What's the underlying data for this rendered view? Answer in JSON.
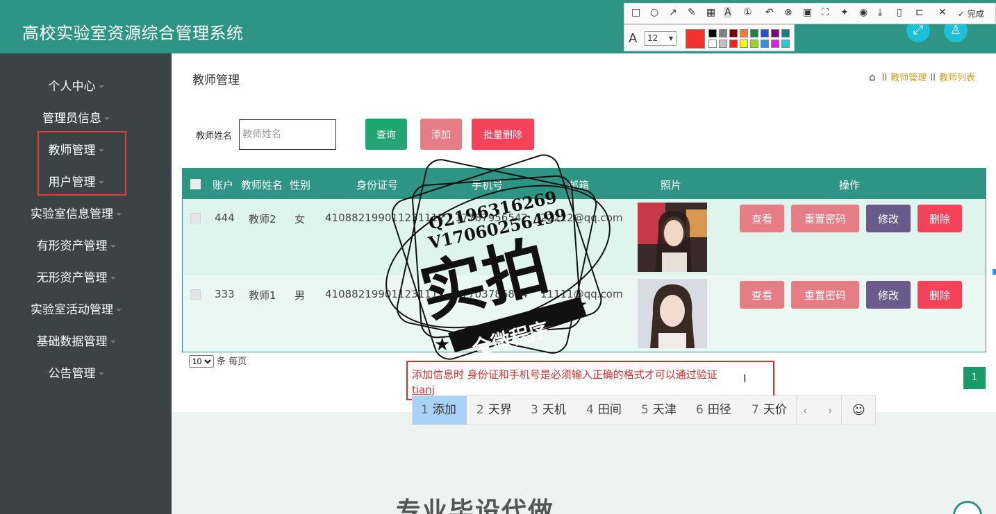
{
  "app": {
    "title": "高校实验室资源综合管理系统"
  },
  "header": {
    "fullscreen_icon": "fullscreen-icon",
    "user_icon": "user-icon"
  },
  "sidebar": {
    "items": [
      {
        "label": "个人中心"
      },
      {
        "label": "管理员信息"
      },
      {
        "label": "教师管理"
      },
      {
        "label": "用户管理"
      },
      {
        "label": "实验室信息管理"
      },
      {
        "label": "有形资产管理"
      },
      {
        "label": "无形资产管理"
      },
      {
        "label": "实验室活动管理"
      },
      {
        "label": "基础数据管理"
      },
      {
        "label": "公告管理"
      }
    ]
  },
  "page": {
    "title": "教师管理",
    "breadcrumb": {
      "sep": "II",
      "level1": "教师管理",
      "level2": "教师列表"
    }
  },
  "search": {
    "label": "教师姓名",
    "placeholder": "教师姓名",
    "query_label": "查询",
    "add_label": "添加",
    "batch_delete_label": "批量删除"
  },
  "table": {
    "headers": {
      "account": "账户",
      "name": "教师姓名",
      "gender": "性别",
      "id_card": "身份证号",
      "phone": "手机号",
      "email": "邮箱",
      "photo": "照片",
      "actions": "操作"
    },
    "rows": [
      {
        "account": "444",
        "name": "教师2",
        "gender": "女",
        "id_card": "410882199011231112",
        "phone": "17787956542",
        "email": "22222@qq.com"
      },
      {
        "account": "333",
        "name": "教师1",
        "gender": "男",
        "id_card": "410882199011231111",
        "phone": "17703786814",
        "email": "11111@qq.com"
      }
    ],
    "actions": {
      "view": "查看",
      "reset": "重置密码",
      "edit": "修改",
      "delete": "删除"
    }
  },
  "pagination": {
    "page_size": "10",
    "page_size_suffix": "条 每页",
    "current_page": "1"
  },
  "annotation": {
    "text": "添加信息时 身份证和手机号是必须输入正确的格式才可以通过验证",
    "input": "tianj"
  },
  "ime": {
    "candidates": [
      {
        "num": "1",
        "word": "添加"
      },
      {
        "num": "2",
        "word": "天界"
      },
      {
        "num": "3",
        "word": "天机"
      },
      {
        "num": "4",
        "word": "田间"
      },
      {
        "num": "5",
        "word": "天津"
      },
      {
        "num": "6",
        "word": "田径"
      },
      {
        "num": "7",
        "word": "天价"
      }
    ],
    "prev": "‹",
    "next": "›",
    "emoji": "☺"
  },
  "bottom": {
    "text": "专业毕设代做"
  },
  "toolbar": {
    "done_label": "完成",
    "font_size": "12",
    "current_color": "#f4332f",
    "swatches": [
      "#000000",
      "#808080",
      "#800000",
      "#f08030",
      "#208040",
      "#2050d0",
      "#800080",
      "#108080",
      "#ffffff",
      "#c0c0c0",
      "#ff2020",
      "#ffff00",
      "#a0d020",
      "#3090e0",
      "#e020e0",
      "#20d0d0"
    ]
  },
  "watermark": {
    "line1": "Q2196316269",
    "line2": "V17060256499",
    "main": "实拍",
    "banner": "全微程序"
  }
}
